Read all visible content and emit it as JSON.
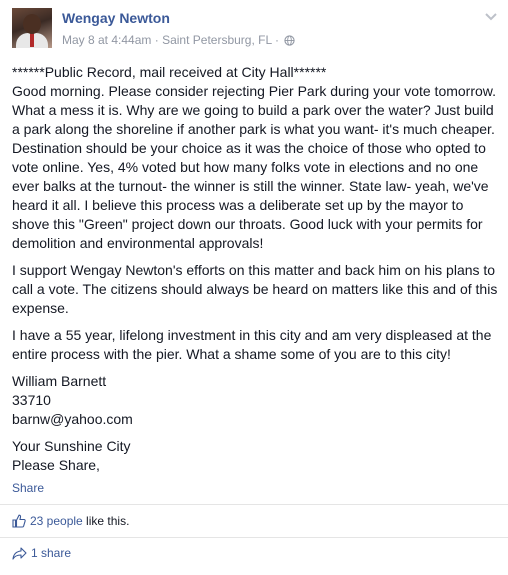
{
  "post": {
    "author": "Wengay Newton",
    "date": "May 8 at 4:44am",
    "separator": "·",
    "location": "Saint Petersburg, FL",
    "separator2": "·",
    "paragraphs": [
      [
        "******Public Record, mail received at City Hall******",
        "Good morning. Please consider rejecting Pier Park during your vote tomorrow.",
        "What a mess it is. Why are we going to build a park over the water? Just build",
        "a park along the shoreline if another park is what you want- it's much cheaper.",
        "Destination should be your choice as it was the choice of those who opted to",
        "vote online. Yes, 4% voted but how many folks vote in elections and no one",
        "ever balks at the turnout- the winner is still the winner. State law- yeah, we've",
        "heard it all. I believe this process was a deliberate set up by the mayor to",
        "shove this \"Green\" project down our throats. Good luck with your permits for",
        "demolition and environmental approvals!"
      ],
      [
        "I support Wengay Newton's efforts on this matter and back him on his plans to",
        "call a vote. The citizens should always be heard on matters like this and of this",
        "expense."
      ],
      [
        "I have a 55 year, lifelong investment in this city and am very displeased at the",
        "entire process with the pier. What a shame some of you are to this city!"
      ],
      [
        "William Barnett",
        "33710",
        "barnw@yahoo.com"
      ],
      [
        "Your Sunshine City",
        "Please Share,"
      ]
    ]
  },
  "actions": {
    "share_label": "Share"
  },
  "likes": {
    "link": "23 people",
    "suffix": " like this."
  },
  "shares": {
    "link": "1 share"
  },
  "icons": {
    "options": "chevron-down-icon",
    "privacy": "globe-icon",
    "like": "thumbs-up-icon",
    "share": "share-arrow-icon"
  },
  "colors": {
    "link": "#3b5998",
    "text": "#141823",
    "meta": "#9197a3",
    "divider": "#e5e5e5"
  }
}
